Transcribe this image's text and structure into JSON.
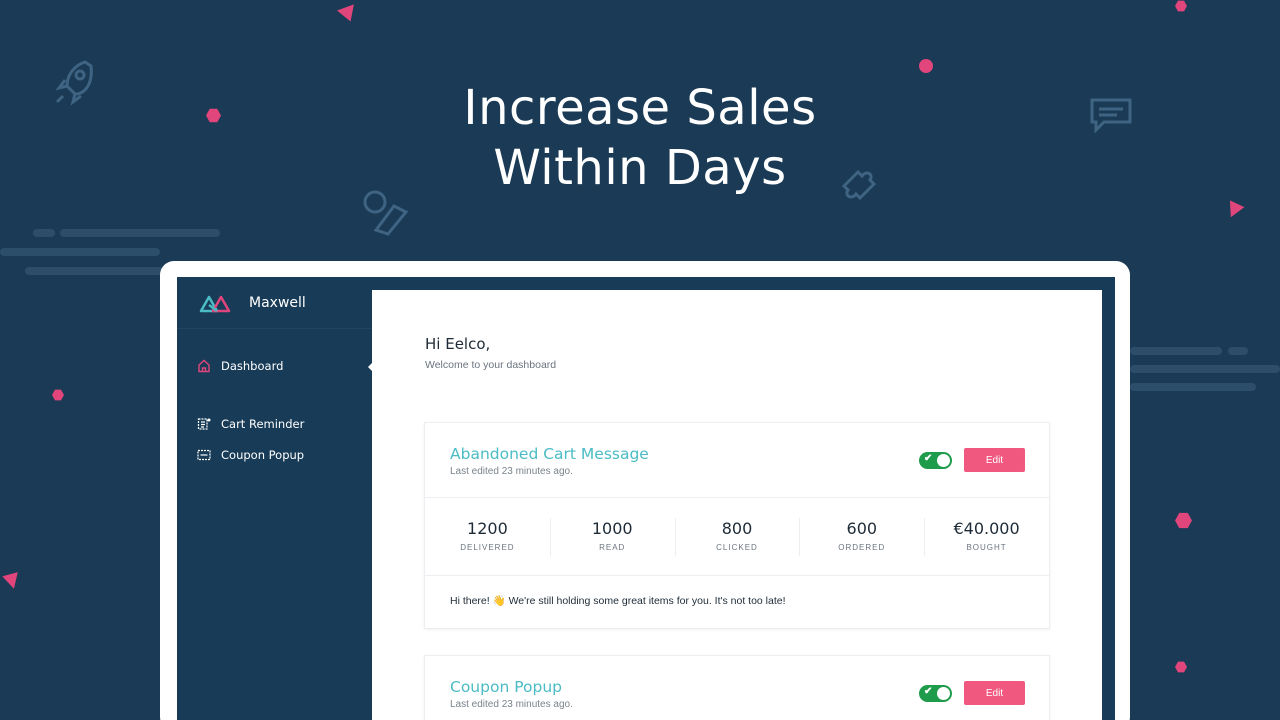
{
  "headline": {
    "line1": "Increase Sales",
    "line2": "Within Days"
  },
  "app": {
    "name": "Maxwell"
  },
  "sidebar": {
    "items": [
      {
        "label": "Dashboard",
        "icon": "home-icon",
        "active": true
      },
      {
        "label": "Cart Reminder",
        "icon": "cart-reminder-icon"
      },
      {
        "label": "Coupon Popup",
        "icon": "coupon-popup-icon"
      }
    ]
  },
  "greeting": {
    "title": "Hi Eelco,",
    "subtitle": "Welcome to your dashboard"
  },
  "cards": [
    {
      "title": "Abandoned Cart Message",
      "meta": "Last edited 23 minutes ago.",
      "enabled": true,
      "edit_label": "Edit",
      "stats": [
        {
          "value": "1200",
          "label": "DELIVERED"
        },
        {
          "value": "1000",
          "label": "READ"
        },
        {
          "value": "800",
          "label": "CLICKED"
        },
        {
          "value": "600",
          "label": "ORDERED"
        },
        {
          "value": "€40.000",
          "label": "BOUGHT"
        }
      ],
      "message": "Hi there! 👋 We're still holding some great items for you. It's not too late!"
    },
    {
      "title": "Coupon Popup",
      "meta": "Last edited 23 minutes ago.",
      "enabled": true,
      "edit_label": "Edit"
    }
  ],
  "colors": {
    "background": "#1a3a55",
    "accent_pink": "#f0587f",
    "accent_teal": "#4bbcc4",
    "toggle_green": "#1f9c4b"
  }
}
